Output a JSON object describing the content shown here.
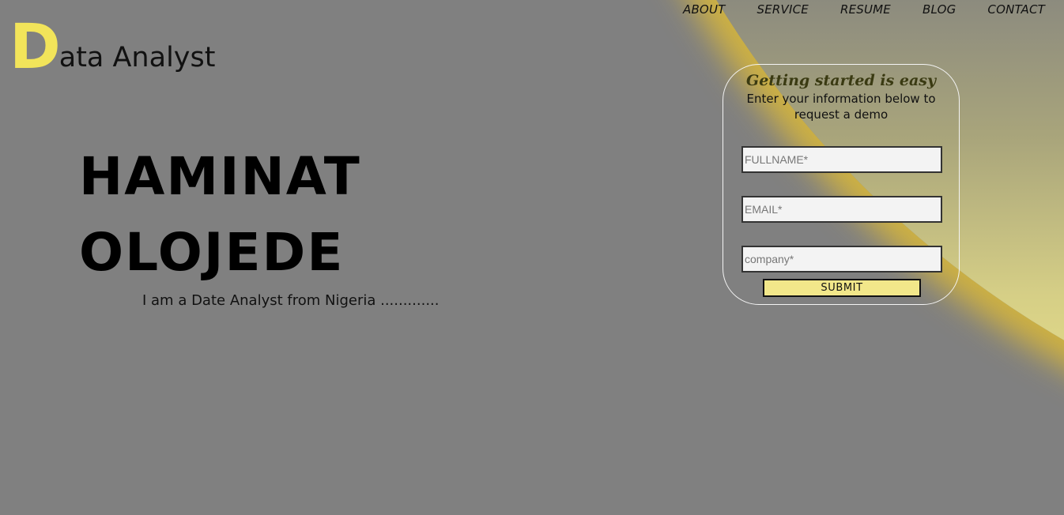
{
  "nav": {
    "items": [
      {
        "label": "ABOUT"
      },
      {
        "label": "SERVICE"
      },
      {
        "label": "RESUME"
      },
      {
        "label": "BLOG"
      },
      {
        "label": "CONTACT"
      }
    ]
  },
  "logo": {
    "initial": "D",
    "rest": "ata Analyst"
  },
  "hero": {
    "first_name": "HAMINAT",
    "last_name": "OLOJEDE",
    "tagline": "I am a Date Analyst from Nigeria ............."
  },
  "form": {
    "title": "Getting started is easy",
    "subtitle": "Enter your information below to request a demo",
    "fullname_placeholder": "FULLNAME*",
    "email_placeholder": "EMAIL*",
    "company_placeholder": "company*",
    "submit_label": "SUBMIT"
  },
  "colors": {
    "background": "#808080",
    "accent_yellow": "#f2e45a",
    "button_yellow": "#f2e78a"
  }
}
